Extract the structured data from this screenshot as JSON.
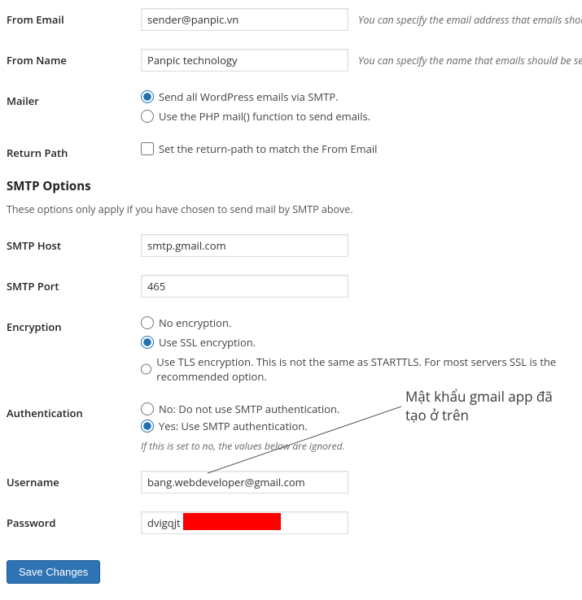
{
  "rows": {
    "from_email": {
      "label": "From Email",
      "value": "sender@panpic.vn",
      "hint": "You can specify the email address that emails should be sent fro"
    },
    "from_name": {
      "label": "From Name",
      "value": "Panpic technology",
      "hint": "You can specify the name that emails should be sent from. If you"
    },
    "mailer": {
      "label": "Mailer",
      "opt_smtp": "Send all WordPress emails via SMTP.",
      "opt_php": "Use the PHP mail() function to send emails."
    },
    "return_path": {
      "label": "Return Path",
      "check_label": "Set the return-path to match the From Email"
    },
    "section_title": "SMTP Options",
    "section_desc": "These options only apply if you have chosen to send mail by SMTP above.",
    "smtp_host": {
      "label": "SMTP Host",
      "value": "smtp.gmail.com"
    },
    "smtp_port": {
      "label": "SMTP Port",
      "value": "465"
    },
    "encryption": {
      "label": "Encryption",
      "opt_none": "No encryption.",
      "opt_ssl": "Use SSL encryption.",
      "opt_tls": "Use TLS encryption. This is not the same as STARTTLS. For most servers SSL is the recommended option."
    },
    "auth": {
      "label": "Authentication",
      "opt_no": "No: Do not use SMTP authentication.",
      "opt_yes": "Yes: Use SMTP authentication.",
      "hint": "If this is set to no, the values below are ignored."
    },
    "username": {
      "label": "Username",
      "value": "bang.webdeveloper@gmail.com"
    },
    "password": {
      "label": "Password",
      "value": "dvigqjt"
    }
  },
  "save_button": "Save Changes",
  "annotation": "Mật khẩu gmail app đã tạo ở trên"
}
